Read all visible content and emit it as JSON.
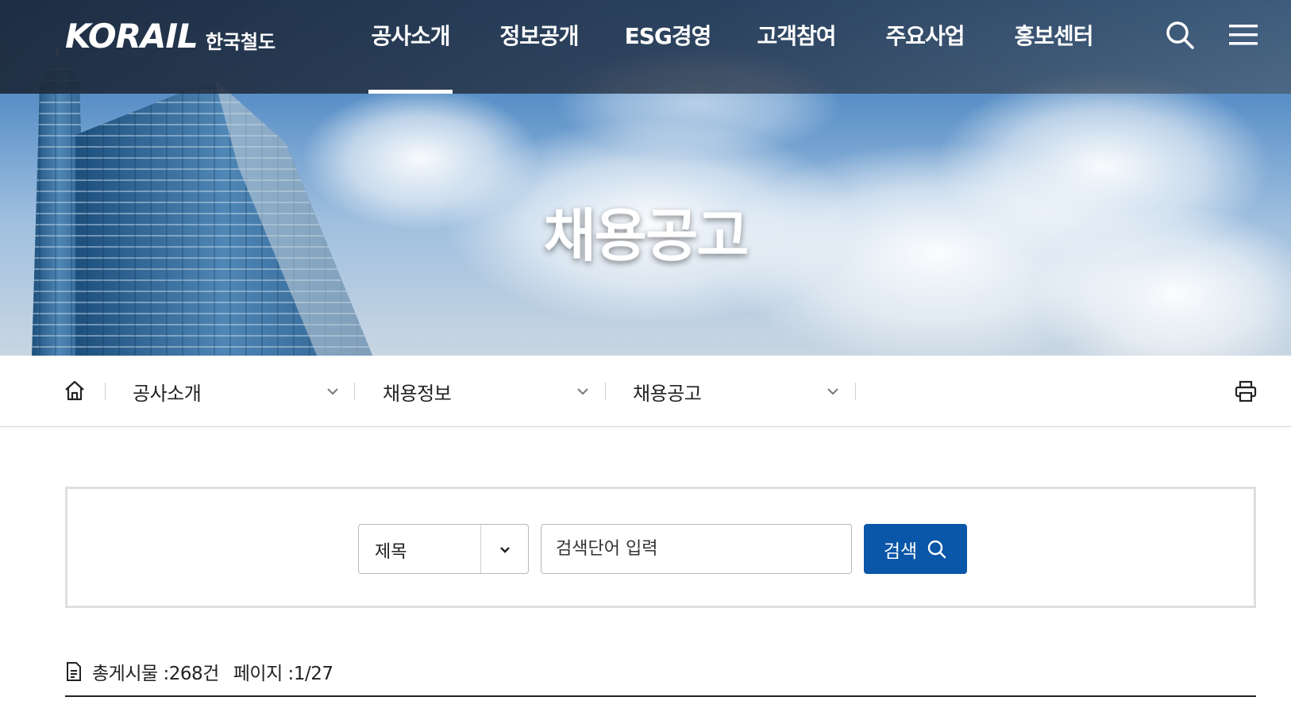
{
  "header": {
    "logo_text": "KORAIL",
    "logo_korean": "한국철도",
    "nav": [
      {
        "label": "공사소개",
        "active": true
      },
      {
        "label": "정보공개",
        "active": false
      },
      {
        "label": "ESG경영",
        "active": false
      },
      {
        "label": "고객참여",
        "active": false
      },
      {
        "label": "주요사업",
        "active": false
      },
      {
        "label": "홍보센터",
        "active": false
      }
    ],
    "icons": [
      "search-icon",
      "menu-icon"
    ]
  },
  "hero": {
    "title": "채용공고"
  },
  "location": {
    "home_icon": "home-icon",
    "depth1": "공사소개",
    "depth2": "채용정보",
    "depth3": "채용공고",
    "print_icon": "printer-icon"
  },
  "search": {
    "select_value": "제목",
    "input_placeholder": "검색단어 입력",
    "button_label": "검색",
    "accent_color": "#0a56a8"
  },
  "stats": {
    "total_label": "총게시물 :",
    "total_count": "268건",
    "page_label": "페이지 :",
    "page_value": "1/27"
  }
}
